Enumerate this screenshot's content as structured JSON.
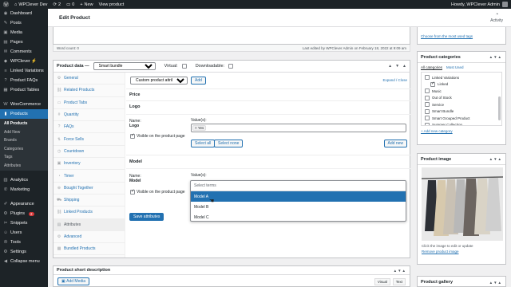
{
  "adminbar": {
    "site_name": "WPClever Dev",
    "updates": "2",
    "comments": "0",
    "new_label": "New",
    "view_product": "View product",
    "howdy": "Howdy, WPClever Admin"
  },
  "sidebar": {
    "items": [
      {
        "icon": "dashboard-icon",
        "glyph": "◉",
        "label": "Dashboard"
      },
      {
        "icon": "pin-icon",
        "glyph": "✎",
        "label": "Posts"
      },
      {
        "icon": "media-icon",
        "glyph": "▣",
        "label": "Media"
      },
      {
        "icon": "pages-icon",
        "glyph": "▤",
        "label": "Pages"
      },
      {
        "icon": "comments-icon",
        "glyph": "✉",
        "label": "Comments"
      },
      {
        "icon": "wpclever-icon",
        "glyph": "◆",
        "label": "WPClever ⚡"
      },
      {
        "icon": "linked-variations-icon",
        "glyph": "≡",
        "label": "Linked Variations"
      },
      {
        "icon": "faq-icon",
        "glyph": "?",
        "label": "Product FAQs"
      },
      {
        "icon": "tables-icon",
        "glyph": "▦",
        "label": "Product Tables"
      }
    ],
    "woo": {
      "icon": "woocommerce-icon",
      "glyph": "W",
      "label": "WooCommerce"
    },
    "products": {
      "icon": "products-icon",
      "glyph": "▮",
      "label": "Products"
    },
    "submenu": [
      "All Products",
      "Add New",
      "Brands",
      "Categories",
      "Tags",
      "Attributes"
    ],
    "lower": [
      {
        "icon": "analytics-icon",
        "glyph": "▥",
        "label": "Analytics",
        "badge": ""
      },
      {
        "icon": "marketing-icon",
        "glyph": "✆",
        "label": "Marketing",
        "badge": ""
      },
      {
        "icon": "appearance-icon",
        "glyph": "✐",
        "label": "Appearance",
        "badge": ""
      },
      {
        "icon": "plugins-icon",
        "glyph": "⚙",
        "label": "Plugins",
        "badge": "2"
      },
      {
        "icon": "snippets-icon",
        "glyph": "✂",
        "label": "Snippets",
        "badge": ""
      },
      {
        "icon": "users-icon",
        "glyph": "☺",
        "label": "Users",
        "badge": ""
      },
      {
        "icon": "tools-icon",
        "glyph": "✇",
        "label": "Tools",
        "badge": ""
      },
      {
        "icon": "settings-icon",
        "glyph": "⚙",
        "label": "Settings",
        "badge": ""
      },
      {
        "icon": "collapse-icon",
        "glyph": "◀",
        "label": "Collapse menu",
        "badge": ""
      }
    ]
  },
  "topbar": {
    "title": "Edit Product",
    "activity": "Activity"
  },
  "editor": {
    "word_count": "Word count: 0",
    "last_edited": "Last edited by WPClever Admin on February 18, 2022 at 9:09 am"
  },
  "product_data": {
    "label": "Product data —",
    "type": "Smart bundle",
    "virtual": "Virtual:",
    "downloadable": "Downloadable:",
    "tabs": [
      {
        "icon": "wrench-icon",
        "glyph": "⚙",
        "label": "General"
      },
      {
        "icon": "link-icon",
        "glyph": "⛓",
        "label": "Related Products"
      },
      {
        "icon": "tab-icon",
        "glyph": "▭",
        "label": "Product Tabs"
      },
      {
        "icon": "quantity-icon",
        "glyph": "#",
        "label": "Quantity"
      },
      {
        "icon": "faq-icon",
        "glyph": "?",
        "label": "FAQs"
      },
      {
        "icon": "force-sells-icon",
        "glyph": "⇅",
        "label": "Force Sells"
      },
      {
        "icon": "countdown-icon",
        "glyph": "◷",
        "label": "Countdown"
      },
      {
        "icon": "inventory-icon",
        "glyph": "▣",
        "label": "Inventory"
      },
      {
        "icon": "timer-icon",
        "glyph": "◔",
        "label": "Timer"
      },
      {
        "icon": "bought-together-icon",
        "glyph": "⊕",
        "label": "Bought Together"
      },
      {
        "icon": "shipping-icon",
        "glyph": "⛟",
        "label": "Shipping"
      },
      {
        "icon": "linked-products-icon",
        "glyph": "⛓",
        "label": "Linked Products"
      },
      {
        "icon": "attributes-icon",
        "glyph": "▤",
        "label": "Attributes"
      },
      {
        "icon": "advanced-icon",
        "glyph": "⚙",
        "label": "Advanced"
      },
      {
        "icon": "bundled-icon",
        "glyph": "▦",
        "label": "Bundled Products"
      }
    ]
  },
  "attributes": {
    "select_value": "Custom product attribute",
    "add_button": "Add",
    "expand_collapse": "Expand / Close",
    "price_title": "Price",
    "logo": {
      "title": "Logo",
      "name_label": "Name:",
      "name_value": "Logo",
      "values_label": "Value(s):",
      "chip": "Yes",
      "visible": "Visible on the product page",
      "select_all": "Select all",
      "select_none": "Select none",
      "add_new": "Add new"
    },
    "model": {
      "title": "Model",
      "name_label": "Name:",
      "name_value": "Model",
      "values_label": "Value(s):",
      "visible": "Visible on the product page",
      "search_placeholder": "Select terms",
      "options": [
        "Model A",
        "Model B",
        "Model C"
      ]
    },
    "save_button": "Save attributes"
  },
  "right": {
    "tags_link": "Choose from the most used tags",
    "categories": {
      "title": "Product categories",
      "tab_all": "All categories",
      "tab_most": "Most Used",
      "items": [
        {
          "label": "Linked Variations",
          "checked": false,
          "sub": false
        },
        {
          "label": "Linked",
          "checked": true,
          "sub": true
        },
        {
          "label": "Music",
          "checked": false,
          "sub": false
        },
        {
          "label": "Out of Stock",
          "checked": false,
          "sub": false
        },
        {
          "label": "Service",
          "checked": false,
          "sub": false
        },
        {
          "label": "Smart Bundle",
          "checked": false,
          "sub": false
        },
        {
          "label": "Smart Grouped Product",
          "checked": false,
          "sub": false
        },
        {
          "label": "Summer Collection",
          "checked": false,
          "sub": false
        }
      ],
      "add_new": "+ Add new category"
    },
    "image": {
      "title": "Product image",
      "hint": "Click the image to edit or update",
      "remove": "Remove product image"
    },
    "gallery": {
      "title": "Product gallery"
    }
  },
  "short_desc": {
    "title": "Product short description",
    "add_media": "Add Media",
    "visual": "Visual",
    "text": "Text"
  }
}
